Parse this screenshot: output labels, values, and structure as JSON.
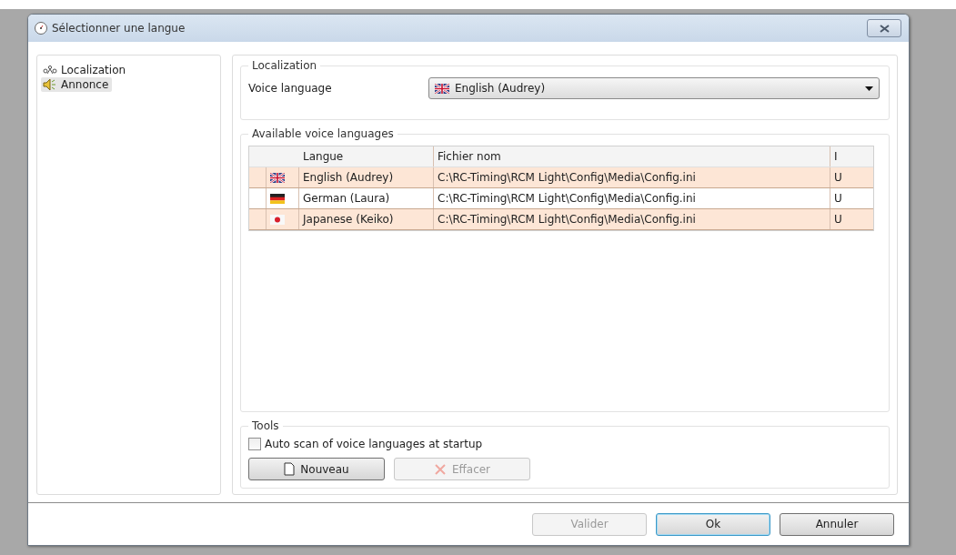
{
  "window": {
    "title": "Sélectionner une langue"
  },
  "sidebar": {
    "items": [
      {
        "label": "Localization",
        "kind": "globe",
        "selected": false
      },
      {
        "label": "Annonce",
        "kind": "speaker",
        "selected": true
      }
    ]
  },
  "localization": {
    "title": "Localization",
    "voice_language": {
      "label": "Voice language",
      "value": "English (Audrey)",
      "kind": "uk"
    }
  },
  "available": {
    "title": "Available voice languages",
    "table": {
      "columns": [
        "Langue",
        "Fichier nom",
        "I"
      ],
      "rows": [
        {
          "kind": "uk",
          "cells": [
            "English (Audrey)",
            "C:\\RC-Timing\\RCM Light\\Config\\Media\\Config.ini",
            "U"
          ]
        },
        {
          "kind": "de",
          "cells": [
            "German (Laura)",
            "C:\\RC-Timing\\RCM Light\\Config\\Media\\Config.ini",
            "U"
          ]
        },
        {
          "kind": "jp",
          "cells": [
            "Japanese (Keiko)",
            "C:\\RC-Timing\\RCM Light\\Config\\Media\\Config.ini",
            "U"
          ]
        }
      ]
    }
  },
  "tools": {
    "title": "Tools",
    "auto_scan": {
      "label": "Auto scan of voice languages at startup",
      "checked": false
    },
    "buttons": [
      {
        "label": "Nouveau",
        "kind": "new",
        "disabled": false
      },
      {
        "label": "Effacer",
        "kind": "delete",
        "disabled": true
      }
    ]
  },
  "footer": {
    "buttons": [
      {
        "label": "Valider",
        "disabled": true,
        "focused": false
      },
      {
        "label": "Ok",
        "disabled": false,
        "focused": true
      },
      {
        "label": "Annuler",
        "disabled": false,
        "focused": false
      }
    ]
  }
}
